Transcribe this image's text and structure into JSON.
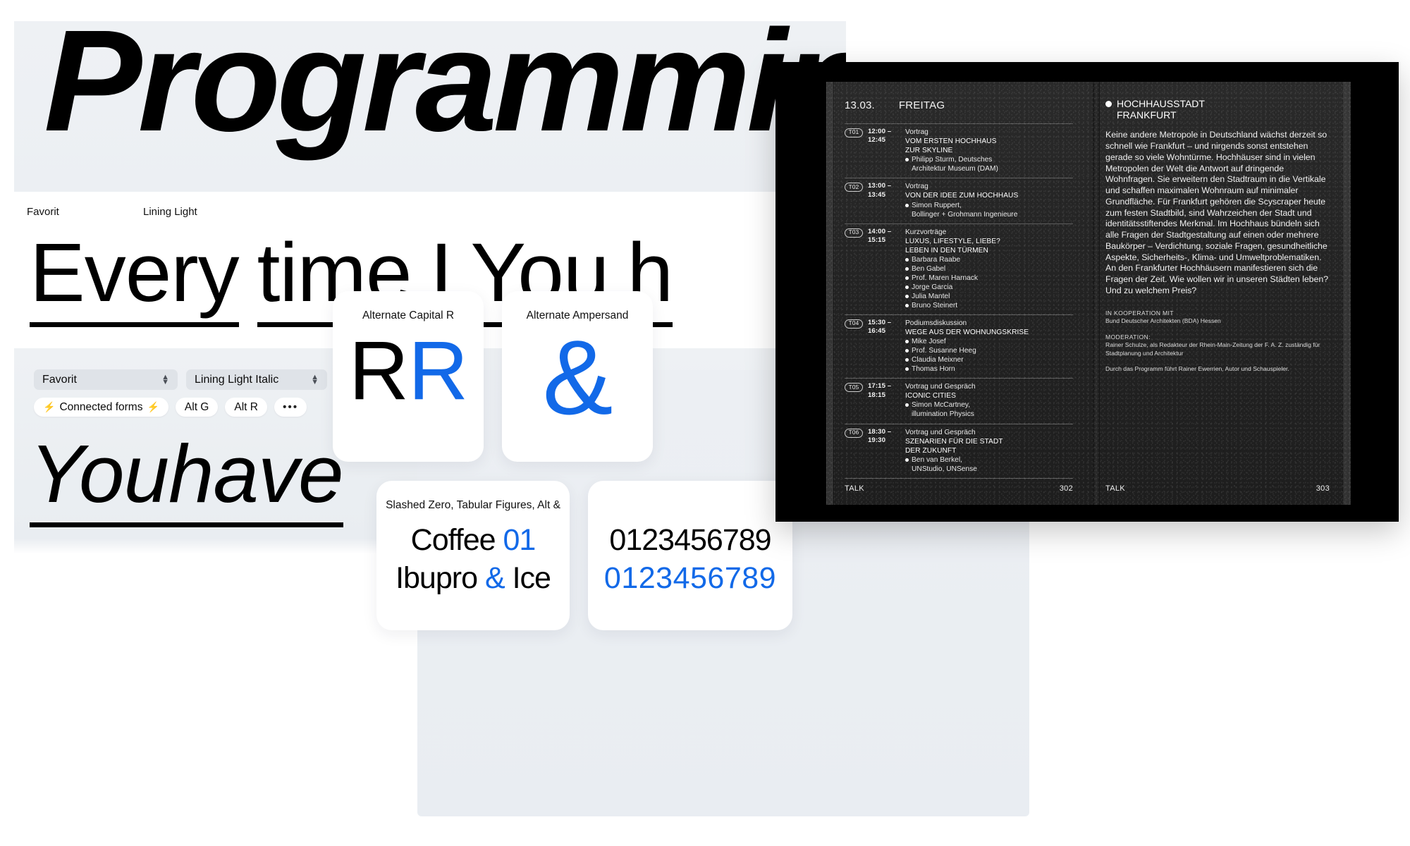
{
  "hero": {
    "word": "Programming"
  },
  "panel_two": {
    "label_family": "Favorit",
    "label_style": "Lining Light",
    "specimen_parts": [
      "Every",
      "time",
      "I",
      "You",
      "h"
    ]
  },
  "controls": {
    "family_select": "Favorit",
    "style_select": "Lining Light Italic",
    "tags": [
      {
        "label": "Connected forms",
        "bolt": "⚡"
      },
      {
        "label": "Alt G"
      },
      {
        "label": "Alt R"
      },
      {
        "label": "•••"
      }
    ],
    "specimen_parts": [
      "You",
      "have"
    ]
  },
  "feature_cards": [
    {
      "id": "alt-capital-r",
      "caption": "Alternate Capital R",
      "glyph_black": "R",
      "glyph_blue": "R"
    },
    {
      "id": "alt-ampersand",
      "caption": "Alternate Ampersand",
      "glyph_black": "",
      "glyph_blue": "&"
    },
    {
      "id": "slashed-zero",
      "caption": "Slashed Zero, Tabular Figures, Alt &",
      "line1_black": "Coffee ",
      "line1_blue": "01",
      "line2_a": "Ibupro ",
      "line2_blue": "&",
      "line2_b": " Ice"
    },
    {
      "id": "numerals",
      "caption": "",
      "row1": "0123456789",
      "row2": "0123456789"
    }
  ],
  "book": {
    "left_page": {
      "date": "13.03.",
      "weekday": "FREITAG",
      "footer_label": "TALK",
      "page_number": "302",
      "schedule": [
        {
          "code": "T01",
          "start": "12:00 –",
          "end": "12:45",
          "kind": "Vortrag",
          "title": [
            "VOM ERSTEN HOCHHAUS",
            "ZUR SKYLINE"
          ],
          "speakers": [
            {
              "name": "Philipp Sturm, Deutsches",
              "cont": "Architektur Museum (DAM)"
            }
          ]
        },
        {
          "code": "T02",
          "start": "13:00 –",
          "end": "13:45",
          "kind": "Vortrag",
          "title": [
            "VON DER IDEE ZUM HOCHHAUS"
          ],
          "speakers": [
            {
              "name": "Simon Ruppert,",
              "cont": "Bollinger + Grohmann Ingenieure"
            }
          ]
        },
        {
          "code": "T03",
          "start": "14:00 –",
          "end": "15:15",
          "kind": "Kurzvorträge",
          "title": [
            "LUXUS, LIFESTYLE, LIEBE?",
            "LEBEN IN DEN TÜRMEN"
          ],
          "speakers": [
            {
              "name": "Barbara Raabe"
            },
            {
              "name": "Ben Gabel"
            },
            {
              "name": "Prof. Maren Harnack"
            },
            {
              "name": "Jorge Garcia"
            },
            {
              "name": "Julia Mantel"
            },
            {
              "name": "Bruno Steinert"
            }
          ]
        },
        {
          "code": "T04",
          "start": "15:30 –",
          "end": "16:45",
          "kind": "Podiumsdiskussion",
          "title": [
            "WEGE AUS DER WOHNUNGSKRISE"
          ],
          "speakers": [
            {
              "name": "Mike Josef"
            },
            {
              "name": "Prof. Susanne Heeg"
            },
            {
              "name": "Claudia Meixner"
            },
            {
              "name": "Thomas Horn"
            }
          ]
        },
        {
          "code": "T05",
          "start": "17:15 –",
          "end": "18:15",
          "kind": "Vortrag und Gespräch",
          "title": [
            "ICONIC CITIES"
          ],
          "speakers": [
            {
              "name": "Simon McCartney,",
              "cont": "illumination Physics"
            }
          ]
        },
        {
          "code": "T06",
          "start": "18:30 –",
          "end": "19:30",
          "kind": "Vortrag und Gespräch",
          "title": [
            "SZENARIEN FÜR DIE STADT",
            "DER ZUKUNFT"
          ],
          "speakers": [
            {
              "name": "Ben van Berkel,",
              "cont": "UNStudio, UNSense"
            }
          ]
        }
      ]
    },
    "right_page": {
      "heading": [
        "HOCHHAUSSTADT",
        "FRANKFURT"
      ],
      "body": "Keine andere Metropole in Deutschland wächst derzeit so schnell wie Frankfurt – und nirgends sonst entstehen gerade so viele Wohntürme. Hochhäuser sind in vielen Metropolen der Welt die Antwort auf dringende Wohnfragen. Sie erweitern den Stadtraum in die Vertikale und schaffen maximalen Wohnraum auf minimaler Grundfläche. Für Frankfurt gehören die Scyscraper heute zum festen Stadtbild, sind Wahrzeichen der Stadt und identitätsstiftendes Merkmal. Im Hochhaus bündeln sich alle Fragen der Stadtgestaltung auf einen oder mehrere Baukörper – Verdichtung, soziale Fragen, gesundheitliche Aspekte, Sicherheits-, Klima- und Umweltproblematiken. An den Frankfurter Hochhäusern manifestieren sich die Fragen der Zeit. Wie wollen wir in unseren Städten leben? Und zu welchem Preis?",
      "credits": [
        {
          "key": "IN KOOPERATION MIT",
          "value": "Bund Deutscher Architekten (BDA) Hessen"
        },
        {
          "key": "MODERATION:",
          "value": "Rainer Schulze, als Redakteur der Rhein-Main-Zeitung der F. A. Z. zuständig für Stadtplanung und Architektur"
        },
        {
          "key": "",
          "value": "Durch das Programm führt Rainer Ewerrien, Autor und Schauspieler."
        }
      ],
      "footer_label": "TALK",
      "page_number": "303"
    }
  },
  "colors": {
    "accent_blue": "#1269e8",
    "panel_bg": "#eceff3",
    "book_black": "#000000"
  }
}
